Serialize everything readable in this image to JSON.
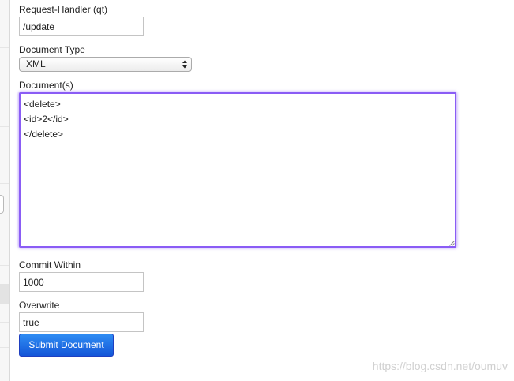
{
  "form": {
    "request_handler": {
      "label": "Request-Handler (qt)",
      "value": "/update"
    },
    "document_type": {
      "label": "Document Type",
      "selected": "XML"
    },
    "documents": {
      "label": "Document(s)",
      "value": "<delete>\n<id>2</id>\n</delete>"
    },
    "commit_within": {
      "label": "Commit Within",
      "value": "1000"
    },
    "overwrite": {
      "label": "Overwrite",
      "value": "true"
    },
    "submit_label": "Submit Document"
  },
  "watermark": "https://blog.csdn.net/oumuv",
  "colors": {
    "focus_border": "#8a5cf5",
    "button_top": "#2f8cf3",
    "button_bottom": "#1456d8"
  }
}
